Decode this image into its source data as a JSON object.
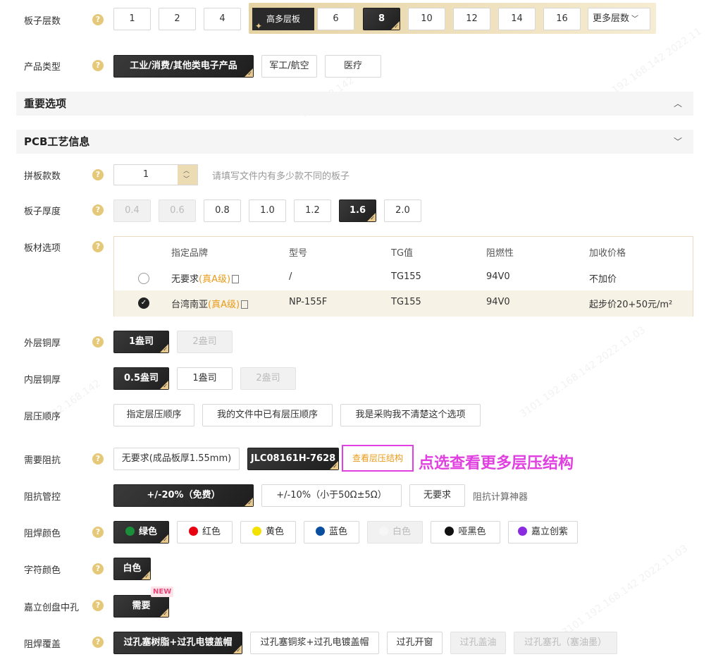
{
  "layers": {
    "label": "板子层数",
    "options": [
      "1",
      "2",
      "4"
    ],
    "hl_badge": "高多层板",
    "hl_options": [
      "6",
      "8",
      "10",
      "12",
      "14",
      "16"
    ],
    "selected": "8",
    "more": "更多层数"
  },
  "product_type": {
    "label": "产品类型",
    "options": [
      "工业/消费/其他类电子产品",
      "军工/航空",
      "医疗"
    ],
    "selected": "工业/消费/其他类电子产品"
  },
  "section_important": {
    "title": "重要选项",
    "chevron": "up"
  },
  "section_pcb": {
    "title": "PCB工艺信息",
    "chevron": "down"
  },
  "panel_count": {
    "label": "拼板款数",
    "value": "1",
    "hint": "请填写文件内有多少款不同的板子"
  },
  "thickness": {
    "label": "板子厚度",
    "options": [
      "0.4",
      "0.6",
      "0.8",
      "1.0",
      "1.2",
      "1.6",
      "2.0"
    ],
    "disabled": [
      "0.4",
      "0.6"
    ],
    "selected": "1.6"
  },
  "material": {
    "label": "板材选项",
    "headers": [
      "指定品牌",
      "型号",
      "TG值",
      "阻燃性",
      "加收价格"
    ],
    "rows": [
      {
        "brand": "无要求",
        "grade": "(真A级)",
        "model": "/",
        "tg": "TG155",
        "flame": "94V0",
        "price": "不加价",
        "selected": false
      },
      {
        "brand": "台湾南亚",
        "grade": "(真A级)",
        "model": "NP-155F",
        "tg": "TG155",
        "flame": "94V0",
        "price": "起步价20+50元/m²",
        "selected": true
      }
    ]
  },
  "outer_copper": {
    "label": "外层铜厚",
    "options": [
      "1盎司",
      "2盎司"
    ],
    "selected": "1盎司",
    "disabled": [
      "2盎司"
    ]
  },
  "inner_copper": {
    "label": "内层铜厚",
    "options": [
      "0.5盎司",
      "1盎司",
      "2盎司"
    ],
    "selected": "0.5盎司",
    "disabled": [
      "2盎司"
    ]
  },
  "stackup_order": {
    "label": "层压顺序",
    "options": [
      "指定层压顺序",
      "我的文件中已有层压顺序",
      "我是采购我不清楚这个选项"
    ]
  },
  "impedance": {
    "label": "需要阻抗",
    "options": [
      "无要求(成品板厚1.55mm)",
      "JLC08161H-7628"
    ],
    "selected": "JLC08161H-7628",
    "view_link": "查看层压结构",
    "annotation": "点选查看更多层压结构"
  },
  "impedance_ctrl": {
    "label": "阻抗管控",
    "options": [
      "+/-20%（免费）",
      "+/-10%（小于50Ω±5Ω）",
      "无要求"
    ],
    "selected": "+/-20%（免费）",
    "calc_link": "阻抗计算神器"
  },
  "solder_color": {
    "label": "阻焊颜色",
    "options": [
      {
        "text": "绿色",
        "color": "#1a8f3a"
      },
      {
        "text": "红色",
        "color": "#e60012"
      },
      {
        "text": "黄色",
        "color": "#f5e100"
      },
      {
        "text": "蓝色",
        "color": "#0a4ea0"
      },
      {
        "text": "白色",
        "color": "#ffffff"
      },
      {
        "text": "哑黑色",
        "color": "#111111"
      },
      {
        "text": "嘉立创紫",
        "color": "#8a2be2"
      }
    ],
    "selected": "绿色",
    "disabled": [
      "白色"
    ]
  },
  "silk_color": {
    "label": "字符颜色",
    "options": [
      "白色"
    ],
    "selected": "白色"
  },
  "pad_hole": {
    "label": "嘉立创盘中孔",
    "options": [
      "需要"
    ],
    "selected": "需要",
    "badge": "NEW"
  },
  "via_cover": {
    "label": "阻焊覆盖",
    "options": [
      "过孔塞树脂+过孔电镀盖帽",
      "过孔塞铜浆+过孔电镀盖帽",
      "过孔开窗",
      "过孔盖油",
      "过孔塞孔（塞油墨）"
    ],
    "selected": "过孔塞树脂+过孔电镀盖帽",
    "disabled": [
      "过孔盖油",
      "过孔塞孔（塞油墨）"
    ]
  },
  "help_glyph": "?",
  "colors": {
    "accent_gold": "#e89b1a",
    "annotation_magenta": "#e040e0",
    "selected_dark": "#2a2a2a"
  }
}
